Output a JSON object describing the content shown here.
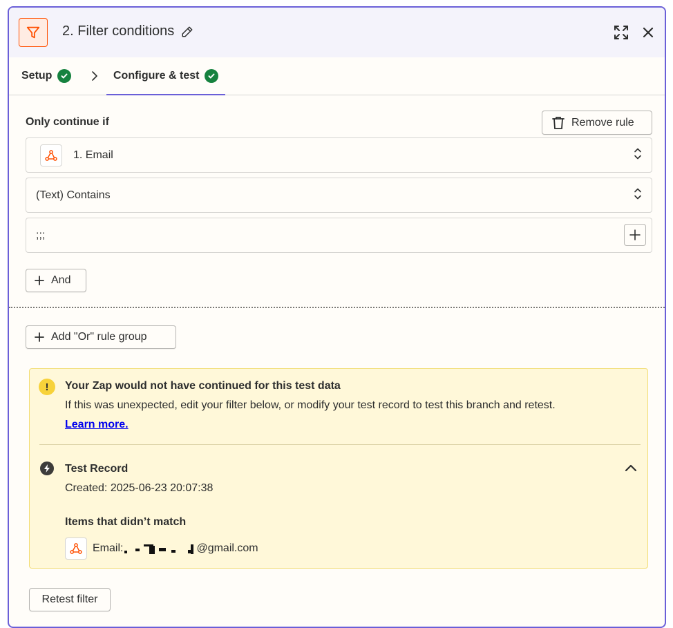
{
  "header": {
    "title": "2. Filter conditions"
  },
  "tabs": [
    {
      "label": "Setup",
      "completed": true
    },
    {
      "label": "Configure & test",
      "completed": true,
      "active": true
    }
  ],
  "rule": {
    "section_label": "Only continue if",
    "remove_label": "Remove rule",
    "field": "1. Email",
    "operator": "(Text) Contains",
    "value": ";;;",
    "and_label": "And"
  },
  "or_group_label": "Add \"Or\" rule group",
  "alert": {
    "title": "Your Zap would not have continued for this test data",
    "body": "If this was unexpected, edit your filter below, or modify your test record to test this branch and retest.",
    "link": "Learn more.",
    "record_title": "Test Record",
    "created": "Created: 2025-06-23 20:07:38",
    "items_label": "Items that didn’t match",
    "item_prefix": "Email:",
    "item_suffix": "@gmail.com"
  },
  "retest_label": "Retest filter",
  "colors": {
    "accent": "#6a5fd8",
    "brand": "#ff4f00",
    "success": "#16823f",
    "warning_bg": "#fff8d9"
  }
}
